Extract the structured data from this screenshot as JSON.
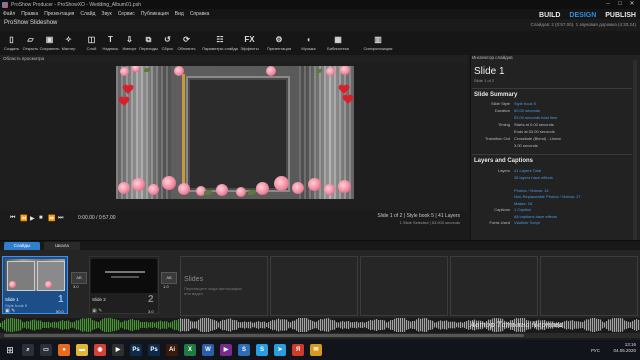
{
  "window": {
    "title": "ProShow Producer - ProShowXO - Wedding_Album01.psh",
    "controls": [
      "minimize-icon",
      "maximize-icon",
      "close-icon"
    ]
  },
  "menu": [
    "Файл",
    "Правка",
    "Презентация",
    "Слайд",
    "Звук",
    "Сервис",
    "Публикация",
    "Вид",
    "Справка"
  ],
  "modes": {
    "build": "BUILD",
    "design": "DESIGN",
    "publish": "PUBLISH"
  },
  "stats": "Слайдов: 2 (0:57.00), 1 звуковая дорожка (4:33.24)",
  "show_title": "ProShow Slideshow",
  "toolbar": [
    {
      "label": "Создать",
      "icon": "new-icon"
    },
    {
      "label": "Открыть",
      "icon": "open-icon"
    },
    {
      "label": "Сохранить",
      "icon": "save-icon"
    },
    {
      "label": "Мастер",
      "icon": "wizard-icon"
    },
    {
      "label": "Слой",
      "icon": "layer-icon"
    },
    {
      "label": "Надпись",
      "icon": "caption-icon"
    },
    {
      "label": "Импорт",
      "icon": "import-icon"
    },
    {
      "label": "Переходы",
      "icon": "transitions-icon"
    },
    {
      "label": "Сброс",
      "icon": "reset-icon"
    },
    {
      "label": "Обновить",
      "icon": "refresh-icon"
    },
    {
      "label": "Параметры слайда",
      "icon": "slide-options-icon"
    },
    {
      "label": "Эффекты",
      "icon": "effects-icon"
    },
    {
      "label": "Презентация",
      "icon": "show-options-icon"
    },
    {
      "label": "Музыка",
      "icon": "music-icon"
    },
    {
      "label": "Библиотека",
      "icon": "library-icon"
    },
    {
      "label": "Синхронизация",
      "icon": "sync-icon"
    }
  ],
  "preview": {
    "header": "Область просмотра",
    "time": "0:00.00 / 0:57.00",
    "slide_info": "Slide 1 of 2  |  Style book 5  |  41 Layers",
    "slide_info2": "1 Slide Selected  |  53.000 seconds"
  },
  "inspector": {
    "header": "Инспектор слайдов",
    "title": "Slide 1",
    "subtitle": "Slide 1 of 2",
    "summary_title": "Slide Summary",
    "summary": [
      {
        "key": "Slide Style",
        "value": "Style book 5",
        "link": true
      },
      {
        "key": "Duration",
        "value": "50.00 seconds",
        "link": true
      },
      {
        "key": "",
        "value": "53.00 seconds total time",
        "link": true
      },
      {
        "key": "Timing",
        "value": "Starts at 0.00 seconds",
        "link": false
      },
      {
        "key": "",
        "value": "Ends at 53.00 seconds",
        "link": false
      },
      {
        "key": "Transition Out",
        "value": "Crossfade (Blend) - Linear",
        "link": false
      },
      {
        "key": "",
        "value": "3.00 seconds",
        "link": false
      }
    ],
    "layers_title": "Layers and Captions",
    "layers": [
      {
        "key": "Layers",
        "value": "41 Layers Total",
        "link": true
      },
      {
        "key": "",
        "value": "38 layers have effects",
        "link": true
      },
      {
        "key": "",
        "value": "",
        "link": false
      },
      {
        "key": "",
        "value": "Photos / Videos: 14",
        "link": true
      },
      {
        "key": "",
        "value": "Non-Replaceable Photos / Videos: 27",
        "link": true
      },
      {
        "key": "",
        "value": "Masks: 18",
        "link": true
      },
      {
        "key": "Captions",
        "value": "1 Caption",
        "link": true
      },
      {
        "key": "",
        "value": "All captions have effects",
        "link": true
      },
      {
        "key": "Fonts Used",
        "value": "Vladimir Script",
        "link": true
      }
    ]
  },
  "tabs": {
    "slides": "Слайды",
    "timeline": "Шкала"
  },
  "slides": [
    {
      "label": "Slide 1",
      "style": "Style book 5",
      "number": "1",
      "duration": "50.0",
      "selected": true
    },
    {
      "label": "Slide 2",
      "number": "2",
      "duration": "3.0",
      "transition": "1.0",
      "selected": false
    }
  ],
  "slide1_transition": "3.0",
  "empty_hint": {
    "title": "Slides",
    "text": "Перетащите сюда фотографии или видео"
  },
  "watermark": "Автор Татьяна Чернова",
  "taskbar": {
    "icons": [
      {
        "name": "search-icon",
        "color": "#2a2f3a",
        "glyph": "⌕"
      },
      {
        "name": "task-view-icon",
        "color": "#2a2f3a",
        "glyph": "▭"
      },
      {
        "name": "firefox-icon",
        "color": "#e76a1f",
        "glyph": "●"
      },
      {
        "name": "explorer-icon",
        "color": "#e2b53b",
        "glyph": "▬"
      },
      {
        "name": "chrome-icon",
        "color": "#d64037",
        "glyph": "◉"
      },
      {
        "name": "media-icon",
        "color": "#2f2f2f",
        "glyph": "▶"
      },
      {
        "name": "photoshop-icon",
        "color": "#0e2a4a",
        "glyph": "Ps"
      },
      {
        "name": "photoshop2-icon",
        "color": "#0e2a4a",
        "glyph": "Ps"
      },
      {
        "name": "illustrator-icon",
        "color": "#3a1a0a",
        "glyph": "Ai"
      },
      {
        "name": "excel-icon",
        "color": "#1f7a44",
        "glyph": "X"
      },
      {
        "name": "word-icon",
        "color": "#2b5faa",
        "glyph": "W"
      },
      {
        "name": "player-icon",
        "color": "#7a2a8a",
        "glyph": "▶"
      },
      {
        "name": "proshow-icon",
        "color": "#2c6db5",
        "glyph": "S"
      },
      {
        "name": "skype-icon",
        "color": "#2a9de0",
        "glyph": "S"
      },
      {
        "name": "telegram-icon",
        "color": "#2a9de0",
        "glyph": "➤"
      },
      {
        "name": "yandex-icon",
        "color": "#d03a2a",
        "glyph": "Я"
      },
      {
        "name": "mail-icon",
        "color": "#d69a1f",
        "glyph": "✉"
      }
    ],
    "lang": "РУС",
    "time": "13:16",
    "date": "04.05.2020"
  }
}
